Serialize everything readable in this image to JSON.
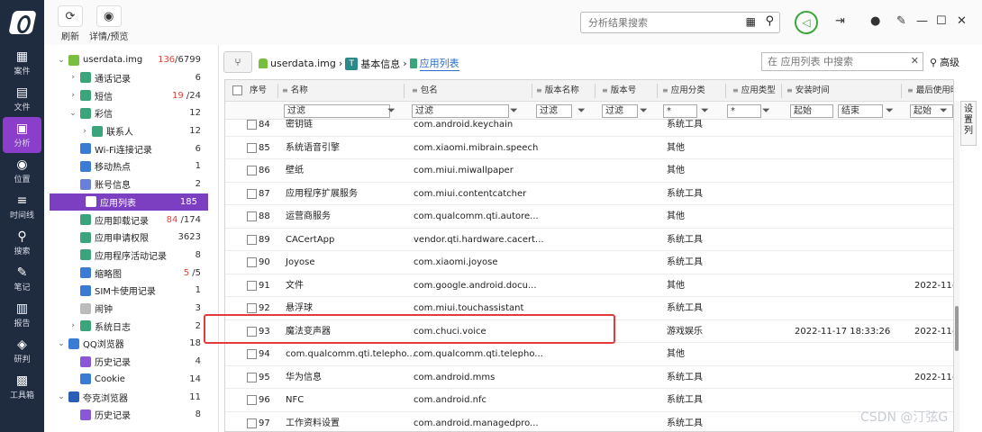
{
  "leftnav": [
    {
      "icon": "folder-icon",
      "glyph": "▦",
      "label": "案件"
    },
    {
      "icon": "file-icon",
      "glyph": "▤",
      "label": "文件"
    },
    {
      "icon": "chart-icon",
      "glyph": "▣",
      "label": "分析",
      "active": true
    },
    {
      "icon": "location-icon",
      "glyph": "◉",
      "label": "位置"
    },
    {
      "icon": "timeline-icon",
      "glyph": "≡",
      "label": "时间线"
    },
    {
      "icon": "search-icon",
      "glyph": "⚲",
      "label": "搜索"
    },
    {
      "icon": "note-icon",
      "glyph": "✎",
      "label": "笔记"
    },
    {
      "icon": "report-icon",
      "glyph": "▥",
      "label": "报告"
    },
    {
      "icon": "research-icon",
      "glyph": "◈",
      "label": "研判"
    },
    {
      "icon": "toolbox-icon",
      "glyph": "▩",
      "label": "工具箱"
    }
  ],
  "toolbar": {
    "refresh_label": "刷新",
    "preview_label": "详情/预览",
    "search_placeholder": "分析结果搜索"
  },
  "tree": [
    {
      "indent": 0,
      "arrow": "⌄",
      "color": "#79bf3f",
      "label": "userdata.img",
      "count": "6799",
      "count_red": "136",
      "sep": "/"
    },
    {
      "indent": 1,
      "arrow": "›",
      "color": "#3aa57b",
      "label": "通话记录",
      "count": "6"
    },
    {
      "indent": 1,
      "arrow": "›",
      "color": "#3aa57b",
      "label": "短信",
      "count": "24",
      "count_red": "19",
      "sep": " /"
    },
    {
      "indent": 1,
      "arrow": "⌄",
      "color": "#3aa57b",
      "label": "彩信",
      "count": "12"
    },
    {
      "indent": 2,
      "arrow": "›",
      "color": "#3aa57b",
      "label": "联系人",
      "count": "12"
    },
    {
      "indent": 1,
      "arrow": "",
      "color": "#3a7bd5",
      "label": "Wi-Fi连接记录",
      "count": "6"
    },
    {
      "indent": 1,
      "arrow": "",
      "color": "#3a7bd5",
      "label": "移动热点",
      "count": "1"
    },
    {
      "indent": 1,
      "arrow": "",
      "color": "#6a7fd9",
      "label": "账号信息",
      "count": "2"
    },
    {
      "indent": 1,
      "arrow": "",
      "color": "#3aa57b",
      "label": "应用列表",
      "count": "185",
      "selected": true
    },
    {
      "indent": 1,
      "arrow": "",
      "color": "#3aa57b",
      "label": "应用卸载记录",
      "count": "174",
      "count_red": "84",
      "sep": " /"
    },
    {
      "indent": 1,
      "arrow": "",
      "color": "#3aa57b",
      "label": "应用申请权限",
      "count": "3623"
    },
    {
      "indent": 1,
      "arrow": "",
      "color": "#3aa57b",
      "label": "应用程序活动记录",
      "count": "8"
    },
    {
      "indent": 1,
      "arrow": "",
      "color": "#3a7bd5",
      "label": "缩略图",
      "count": "5",
      "count_red": "5",
      "sep": " /"
    },
    {
      "indent": 1,
      "arrow": "",
      "color": "#3a7bd5",
      "label": "SIM卡使用记录",
      "count": "1"
    },
    {
      "indent": 1,
      "arrow": "",
      "color": "#bbbbbb",
      "label": "闹钟",
      "count": "3"
    },
    {
      "indent": 1,
      "arrow": "›",
      "color": "#3aa57b",
      "label": "系统日志",
      "count": "2"
    },
    {
      "indent": 0,
      "arrow": "⌄",
      "color": "#3a7bd5",
      "label": "QQ浏览器",
      "count": "18"
    },
    {
      "indent": 1,
      "arrow": "",
      "color": "#8a57d8",
      "label": "历史记录",
      "count": "4"
    },
    {
      "indent": 1,
      "arrow": "",
      "color": "#3a7bd5",
      "label": "Cookie",
      "count": "14"
    },
    {
      "indent": 0,
      "arrow": "⌄",
      "color": "#2a5fb5",
      "label": "夸克浏览器",
      "count": "11"
    },
    {
      "indent": 1,
      "arrow": "",
      "color": "#8a57d8",
      "label": "历史记录",
      "count": "8"
    }
  ],
  "breadcrumb": {
    "root": "userdata.img",
    "mid_icon": "T",
    "mid": "基本信息",
    "current": "应用列表",
    "search_placeholder": "在 应用列表 中搜索",
    "advanced": "高级"
  },
  "table": {
    "columns": [
      "序号",
      "名称",
      "包名",
      "版本名称",
      "版本号",
      "应用分类",
      "应用类型",
      "安装时间",
      "最后使用时间"
    ],
    "filters": {
      "name": "过滤",
      "package": "过滤",
      "version_name": "过滤",
      "version_code": "过滤",
      "category": "*",
      "type": "*",
      "install_start": "起始",
      "install_end": "结束",
      "last_start": "起始"
    },
    "side_label": "设置列",
    "rows": [
      {
        "no": "84",
        "name": "密钥链",
        "pkg": "com.android.keychain",
        "cat": "系统工具",
        "install": "",
        "last": ""
      },
      {
        "no": "85",
        "name": "系统语音引擎",
        "pkg": "com.xiaomi.mibrain.speech",
        "cat": "其他",
        "install": "",
        "last": ""
      },
      {
        "no": "86",
        "name": "壁纸",
        "pkg": "com.miui.miwallpaper",
        "cat": "其他",
        "install": "",
        "last": ""
      },
      {
        "no": "87",
        "name": "应用程序扩展服务",
        "pkg": "com.miui.contentcatcher",
        "cat": "系统工具",
        "install": "",
        "last": ""
      },
      {
        "no": "88",
        "name": "运营商服务",
        "pkg": "com.qualcomm.qti.autore...",
        "cat": "其他",
        "install": "",
        "last": ""
      },
      {
        "no": "89",
        "name": "CACertApp",
        "pkg": "vendor.qti.hardware.cacert...",
        "cat": "系统工具",
        "install": "",
        "last": ""
      },
      {
        "no": "90",
        "name": "Joyose",
        "pkg": "com.xiaomi.joyose",
        "cat": "系统工具",
        "install": "",
        "last": ""
      },
      {
        "no": "91",
        "name": "文件",
        "pkg": "com.google.android.docu...",
        "cat": "其他",
        "install": "",
        "last": "2022-11-1"
      },
      {
        "no": "92",
        "name": "悬浮球",
        "pkg": "com.miui.touchassistant",
        "cat": "系统工具",
        "install": "",
        "last": ""
      },
      {
        "no": "93",
        "name": "魔法变声器",
        "pkg": "com.chuci.voice",
        "cat": "游戏娱乐",
        "install": "2022-11-17 18:33:26",
        "last": "2022-11-2"
      },
      {
        "no": "94",
        "name": "com.qualcomm.qti.telepho...",
        "pkg": "com.qualcomm.qti.telepho...",
        "cat": "其他",
        "install": "",
        "last": ""
      },
      {
        "no": "95",
        "name": "华为信息",
        "pkg": "com.android.mms",
        "cat": "系统工具",
        "install": "",
        "last": "2022-11-2"
      },
      {
        "no": "96",
        "name": "NFC",
        "pkg": "com.android.nfc",
        "cat": "系统工具",
        "install": "",
        "last": ""
      },
      {
        "no": "97",
        "name": "工作资料设置",
        "pkg": "com.android.managedpro...",
        "cat": "系统工具",
        "install": "",
        "last": ""
      }
    ]
  },
  "watermark": "CSDN @汀弦G"
}
